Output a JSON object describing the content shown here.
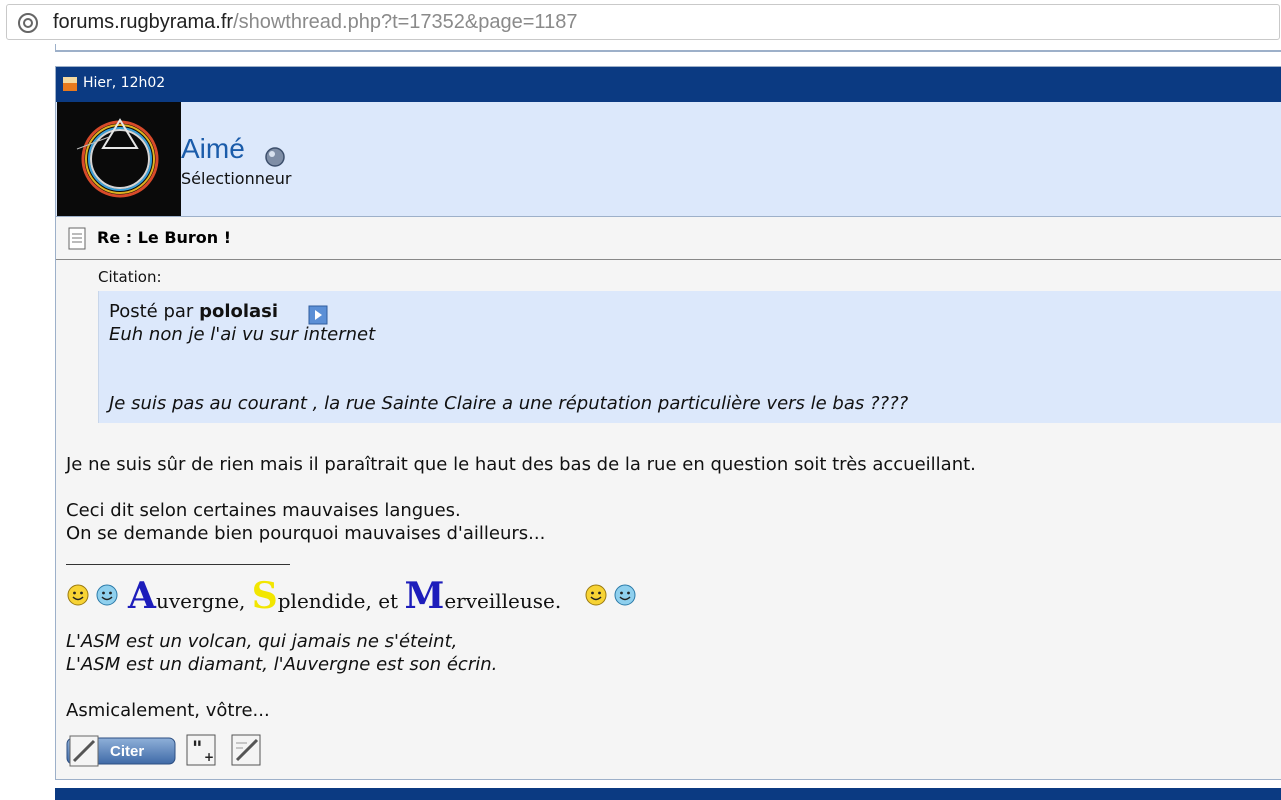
{
  "browser": {
    "url_host": "forums.rugbyrama.fr",
    "url_path": "/showthread.php?t=17352&page=1187"
  },
  "post": {
    "date": "Hier, 12h02",
    "username": "Aimé",
    "user_title": "Sélectionneur",
    "title": "Re : Le Buron !",
    "quote": {
      "label": "Citation:",
      "posted_by_prefix": "Posté par",
      "author": "pololasi",
      "lines": [
        "Euh non je l'ai vu sur internet",
        "Je suis pas au courant , la rue Sainte Claire a une réputation particulière vers le bas ????"
      ]
    },
    "body": [
      "Je ne suis sûr de rien mais il paraîtrait que le haut des bas de la rue en question soit très accueillant.",
      "Ceci dit selon certaines mauvaises langues.",
      "On se demande bien pourquoi mauvaises d'ailleurs..."
    ],
    "signature": {
      "motto": {
        "a_cap": "A",
        "a_rest": "uvergne,",
        "s_cap": "S",
        "s_rest": "plendide, et",
        "m_cap": "M",
        "m_rest": "erveilleuse."
      },
      "poem": [
        "L'ASM est un volcan, qui jamais ne s'éteint,",
        "L'ASM est un diamant, l'Auvergne est son écrin."
      ],
      "closing": "Asmicalement, vôtre..."
    },
    "buttons": {
      "quote_label": "Citer"
    }
  },
  "colors": {
    "header_blue": "#0b3a82",
    "user_bg": "#dce8fb",
    "username": "#1b5caa",
    "cap_a": "#1d1dbb",
    "cap_s": "#f2e600",
    "cap_m": "#1d1dbb"
  },
  "icons": [
    "globe-icon",
    "post-icon",
    "online-status-icon",
    "document-icon",
    "view-post-icon",
    "smiley-icon",
    "multi-quote-icon",
    "reply-icon"
  ]
}
